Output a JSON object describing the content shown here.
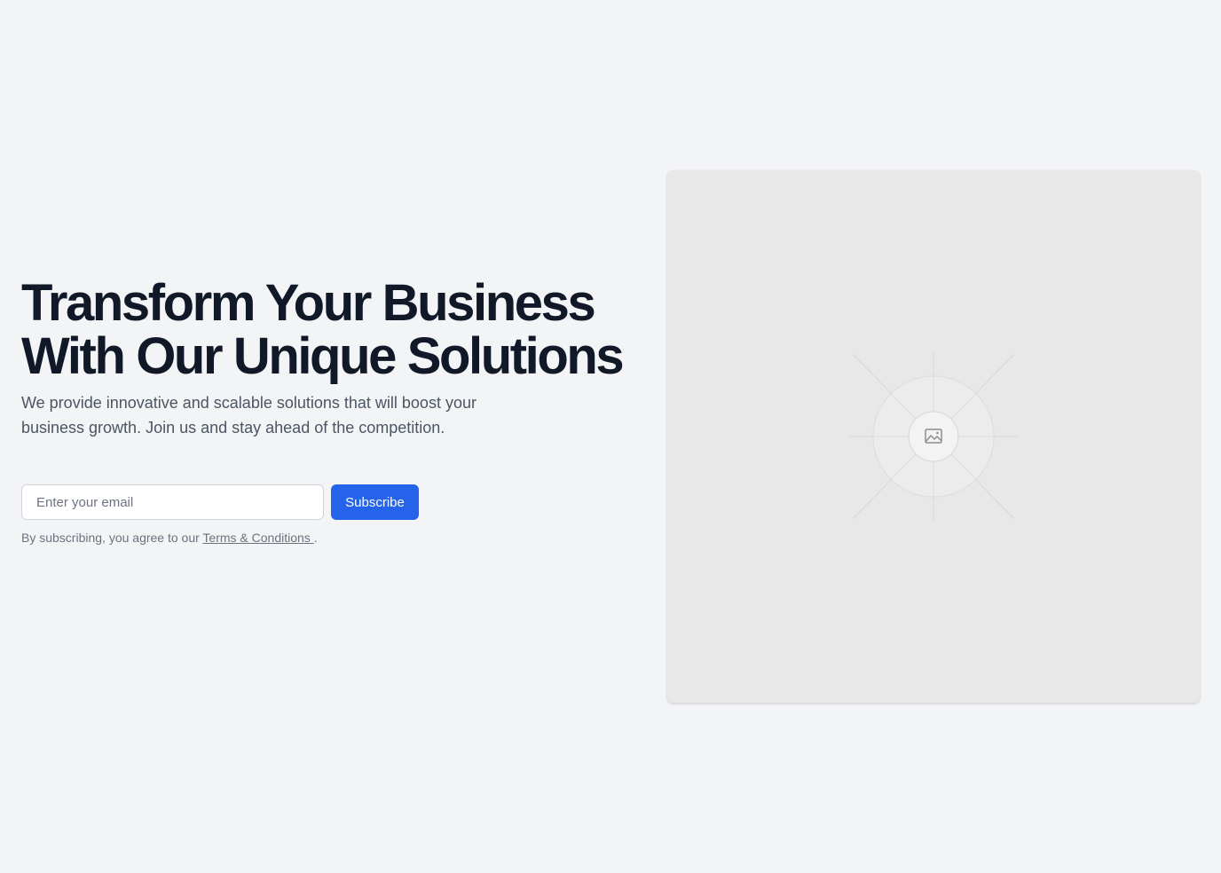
{
  "hero": {
    "title": "Transform Your Business With Our Unique Solutions",
    "subtitle": "We provide innovative and scalable solutions that will boost your business growth. Join us and stay ahead of the competition.",
    "email_placeholder": "Enter your email",
    "subscribe_label": "Subscribe",
    "legal_prefix": "By subscribing, you agree to our ",
    "terms_link": "Terms & Conditions ",
    "legal_suffix": "."
  },
  "media": {
    "icon": "image-placeholder-icon"
  },
  "colors": {
    "background": "#f3f4f6",
    "heading": "#111827",
    "body_text": "#4b5563",
    "accent": "#2563eb",
    "placeholder_bg": "#e8e8e8"
  }
}
